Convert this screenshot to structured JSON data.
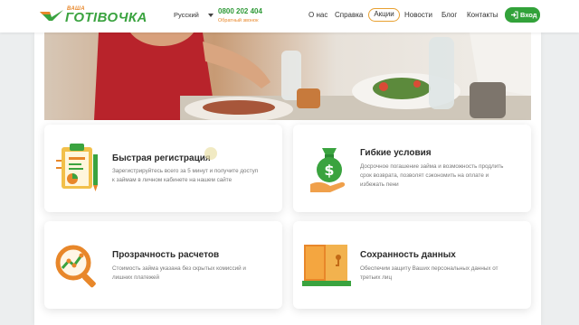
{
  "header": {
    "logo_small": "ВАША",
    "logo_big": "ГОТІВОЧКА",
    "language": "Русский",
    "phone": "0800 202 404",
    "callback": "Обратный звонок",
    "nav": {
      "about": "О нас",
      "help": "Справка",
      "promo": "Акции",
      "news": "Новости",
      "blog": "Блог",
      "contacts": "Контакты"
    },
    "login": "Вход"
  },
  "features": [
    {
      "title": "Быстрая регистрация",
      "desc_1": "Зарегистрируйтесь всего за 5 минут и получите доступ",
      "desc_2": "к займам в личном кабинете на нашем сайте"
    },
    {
      "title": "Гибкие условия",
      "desc_1": "Досрочное погашение займа и возможность продлить",
      "desc_2": "срок возврата, позволят сэкономить на оплате и",
      "desc_3": "избежать пени"
    },
    {
      "title": "Прозрачность расчетов",
      "desc_1": "Стоимость займа указана без скрытых комиссий и",
      "desc_2": "лишних платежей"
    },
    {
      "title": "Сохранность данных",
      "desc_1": "Обеспечим защиту Ваших персональных данных от",
      "desc_2": "третьих лиц"
    }
  ],
  "colors": {
    "brand_green": "#32a23a",
    "brand_orange": "#e8872a",
    "promo_border": "#e8a030"
  }
}
